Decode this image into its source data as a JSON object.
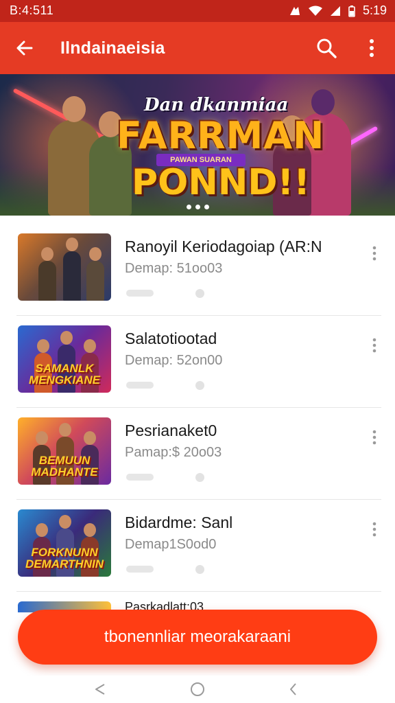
{
  "status_bar": {
    "time": "B:4:511",
    "right_time": "5:19",
    "icons": [
      "signal-icon",
      "wifi-icon",
      "cell-icon",
      "battery-icon"
    ]
  },
  "app_bar": {
    "title": "Ilndainaeisia",
    "icons": [
      "back-arrow-icon",
      "search-icon",
      "more-vert-icon"
    ],
    "color": "#e53b24"
  },
  "banner": {
    "tagline": "Dan dkanmiaa",
    "title_line1": "FARRMAN",
    "ribbon": "PAWAN SUARAN",
    "title_line2": "PONND!!",
    "page_indicator_count": 3
  },
  "items": [
    {
      "name": "Ranoyil Keriodagoiap (AR:N",
      "sub": "Demap: 51oo03",
      "thumb_text": ""
    },
    {
      "name": "Salatotiootad",
      "sub": "Demap: 52on00",
      "thumb_text": "SAMANLK MENGKIANE"
    },
    {
      "name": "Pesrianaket0",
      "sub": "Pamap:$ 20o03",
      "thumb_text": "BEMUUN MADHANTE"
    },
    {
      "name": "Bidardme: Sanl",
      "sub": "Demap1S0od0",
      "thumb_text": "FORKNUNN DEMARTHNIN"
    }
  ],
  "partial_item_name": "Pasrkadlatt:03",
  "fab_label": "tbonennliar meorakaraani",
  "nav_bar": {
    "icons": [
      "nav-back-icon",
      "nav-home-icon",
      "nav-recent-icon"
    ]
  },
  "colors": {
    "accent": "#e53b24",
    "status_bar": "#c0251a",
    "fab": "#ff3d14"
  }
}
